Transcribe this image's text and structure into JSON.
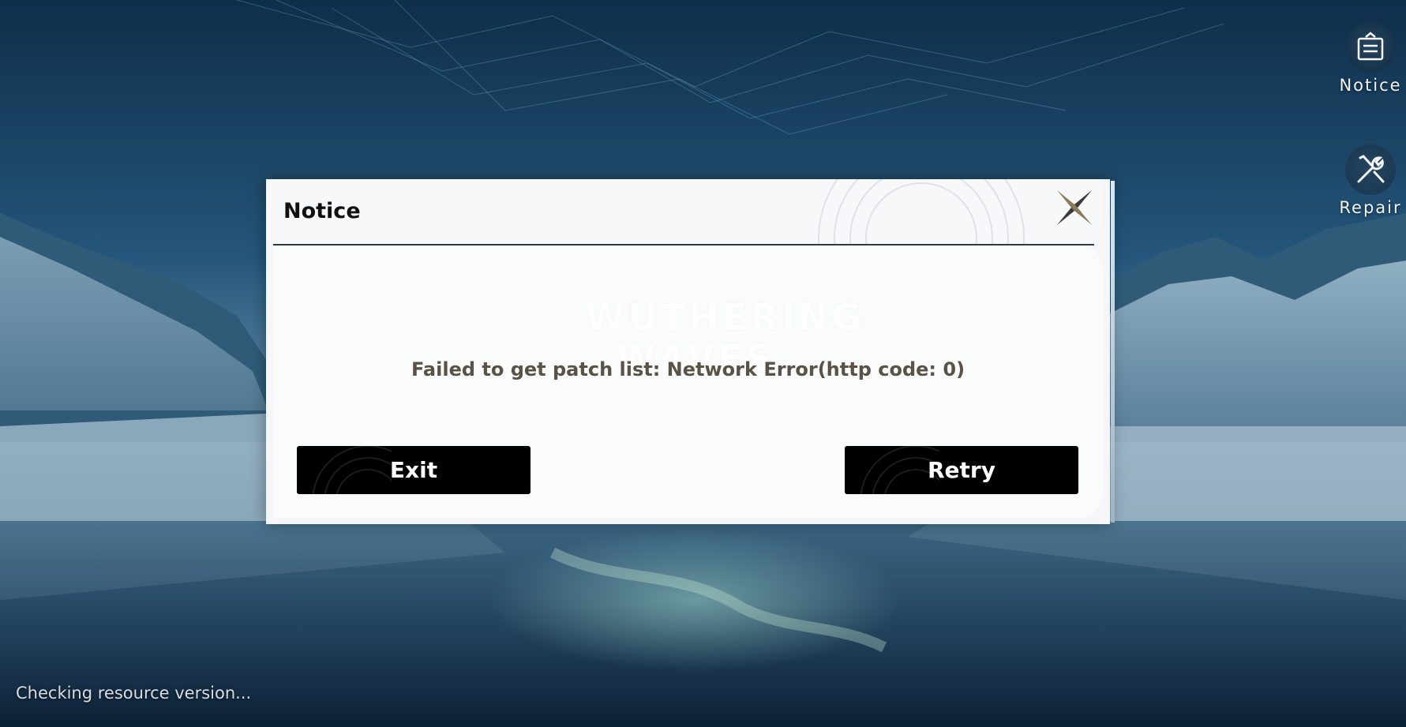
{
  "side_buttons": {
    "notice_label": "Notice",
    "repair_label": "Repair"
  },
  "dialog": {
    "title": "Notice",
    "watermark": [
      "WUTHERING",
      "WAVES"
    ],
    "message": "Failed to get patch list: Network Error(http code: 0)",
    "exit_label": "Exit",
    "retry_label": "Retry"
  },
  "status": {
    "text": "Checking resource version..."
  },
  "colors": {
    "dialog_bg": "#f4f6f8",
    "button_bg": "#000000",
    "message_text": "#5a5247",
    "close_icon_gold": "#8a7a5a"
  },
  "icons": {
    "notice": "notice-board-icon",
    "repair": "wrench-screwdriver-icon",
    "close": "four-point-star-close-icon"
  }
}
